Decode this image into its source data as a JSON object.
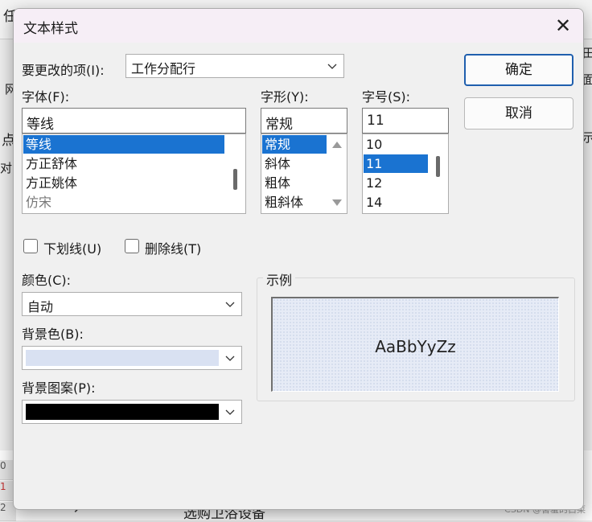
{
  "dialog": {
    "title": "文本样式",
    "close_icon": "close-icon"
  },
  "item_to_change": {
    "label": "要更改的项(I):",
    "value": "工作分配行"
  },
  "buttons": {
    "ok": "确定",
    "cancel": "取消"
  },
  "font": {
    "label": "字体(F):",
    "value": "等线",
    "items": [
      "等线",
      "方正舒体",
      "方正姚体",
      "仿宋"
    ],
    "selected_index": 0
  },
  "style": {
    "label": "字形(Y):",
    "value": "常规",
    "items": [
      "常规",
      "斜体",
      "粗体",
      "粗斜体"
    ],
    "selected_index": 0
  },
  "size": {
    "label": "字号(S):",
    "value": "11",
    "items": [
      "10",
      "11",
      "12",
      "14"
    ],
    "selected_index": 1
  },
  "effects": {
    "underline_label": "下划线(U)",
    "underline_checked": false,
    "strikethrough_label": "删除线(T)",
    "strikethrough_checked": false
  },
  "color": {
    "label": "颜色(C):",
    "value": "自动"
  },
  "bg_color": {
    "label": "背景色(B):",
    "swatch_color": "#d9e1f2"
  },
  "bg_pattern": {
    "label": "背景图案(P):",
    "swatch_color": "#000000"
  },
  "sample": {
    "label": "示例",
    "text": "AaBbYyZz"
  },
  "background": {
    "fragments": [
      "任",
      "网",
      "点",
      "文",
      "对",
      "田",
      "面",
      "示",
      "0",
      "1",
      "2",
      "选购卫浴设备"
    ],
    "watermark": "CSDN @害羞的白菜"
  },
  "colors": {
    "accent": "#1a73d1",
    "default_button_border": "#1f5fae",
    "title_bar": "#f6eef6"
  }
}
